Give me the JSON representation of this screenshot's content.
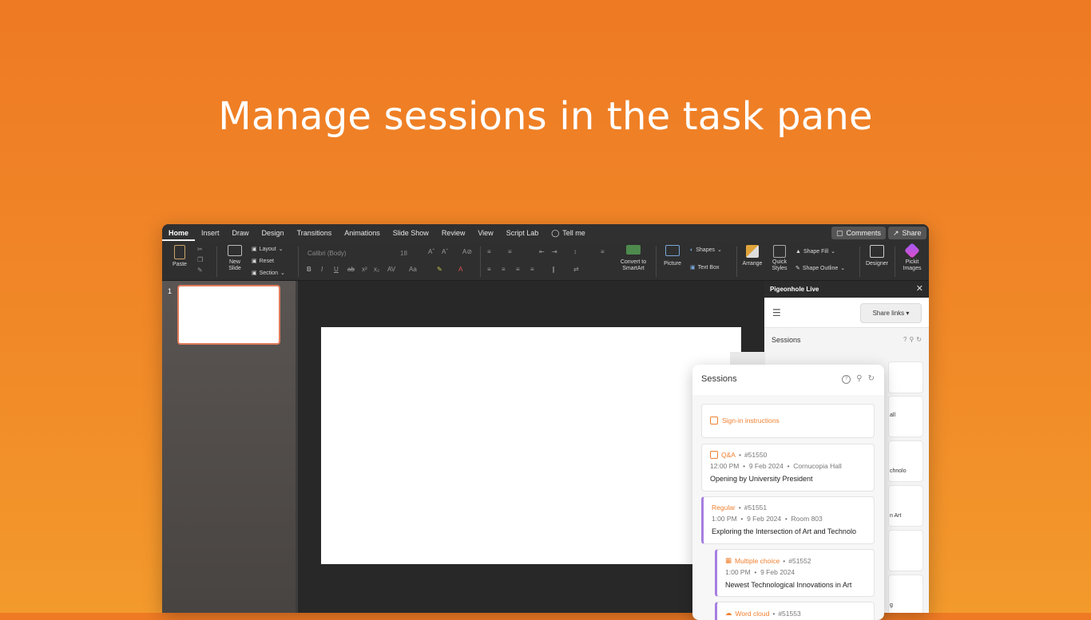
{
  "headline": "Manage sessions in the task pane",
  "tabs": [
    "Home",
    "Insert",
    "Draw",
    "Design",
    "Transitions",
    "Animations",
    "Slide Show",
    "Review",
    "View",
    "Script Lab"
  ],
  "tell_me": "Tell me",
  "comments_label": "Comments",
  "share_label": "Share",
  "ribbon": {
    "paste": "Paste",
    "new_slide_1": "New",
    "new_slide_2": "Slide",
    "layout": "Layout",
    "reset": "Reset",
    "section": "Section",
    "font_name": "Calibri (Body)",
    "font_size": "18",
    "convert_1": "Convert to",
    "convert_2": "SmartArt",
    "picture": "Picture",
    "shapes": "Shapes",
    "text_box": "Text Box",
    "arrange": "Arrange",
    "quick_styles_1": "Quick",
    "quick_styles_2": "Styles",
    "shape_fill": "Shape Fill",
    "shape_outline": "Shape Outline",
    "designer": "Designer",
    "pickit_1": "Pickit",
    "pickit_2": "Images"
  },
  "slide_number": "1",
  "pane": {
    "title": "Pigeonhole Live",
    "share_links": "Share links",
    "sessions_label": "Sessions",
    "bg_fragments": [
      "all",
      "chnolo",
      "n Art",
      "g"
    ]
  },
  "float": {
    "title": "Sessions",
    "signin": "Sign-in instructions",
    "items": [
      {
        "type": "Q&A",
        "id": "#51550",
        "time": "12:00 PM",
        "date": "9 Feb 2024",
        "room": "Cornucopia Hall",
        "title": "Opening by University President"
      },
      {
        "type": "Regular",
        "id": "#51551",
        "time": "1:00 PM",
        "date": "9 Feb 2024",
        "room": "Room 803",
        "title": "Exploring the Intersection of Art and Technolo"
      },
      {
        "type": "Multiple choice",
        "id": "#51552",
        "time": "1:00 PM",
        "date": "9 Feb 2024",
        "title": "Newest Technological Innovations in Art"
      },
      {
        "type": "Word cloud",
        "id": "#51553"
      }
    ]
  },
  "colors": {
    "accent_orange": "#f08030",
    "accent_purple": "#a67ee0",
    "bg_orange": "#ee7a24"
  }
}
